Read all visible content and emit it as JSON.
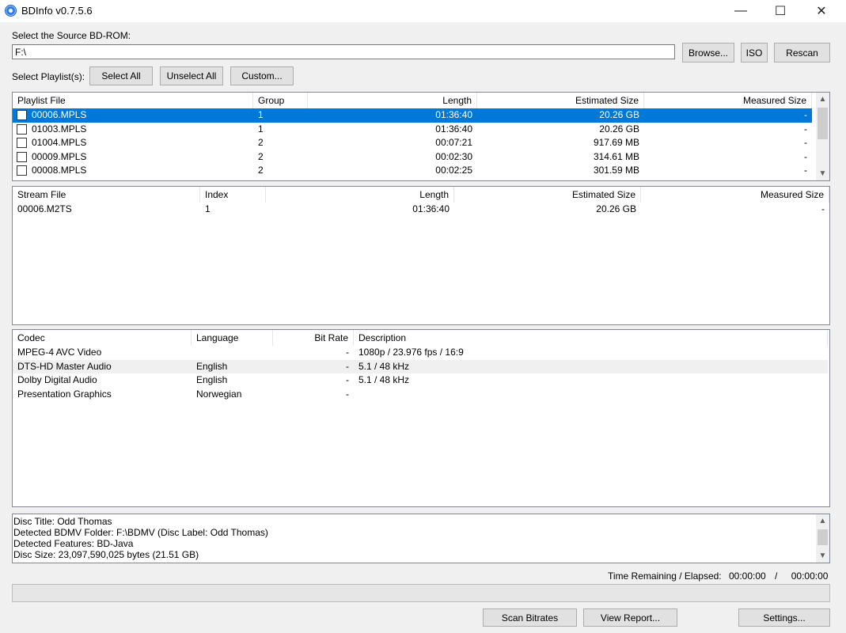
{
  "window": {
    "title": "BDInfo v0.7.5.6",
    "minimize": "—",
    "maximize": "☐",
    "close": "✕"
  },
  "source": {
    "label": "Select the Source BD-ROM:",
    "path": "F:\\",
    "browse_label": "Browse...",
    "iso_label": "ISO",
    "rescan_label": "Rescan"
  },
  "playlist_controls": {
    "label": "Select Playlist(s):",
    "select_all": "Select All",
    "unselect_all": "Unselect All",
    "custom": "Custom..."
  },
  "playlists": {
    "headers": [
      "Playlist File",
      "Group",
      "Length",
      "Estimated Size",
      "Measured Size"
    ],
    "rows": [
      {
        "file": "00006.MPLS",
        "group": "1",
        "length": "01:36:40",
        "est": "20.26 GB",
        "meas": "-",
        "selected": true
      },
      {
        "file": "01003.MPLS",
        "group": "1",
        "length": "01:36:40",
        "est": "20.26 GB",
        "meas": "-"
      },
      {
        "file": "01004.MPLS",
        "group": "2",
        "length": "00:07:21",
        "est": "917.69 MB",
        "meas": "-"
      },
      {
        "file": "00009.MPLS",
        "group": "2",
        "length": "00:02:30",
        "est": "314.61 MB",
        "meas": "-"
      },
      {
        "file": "00008.MPLS",
        "group": "2",
        "length": "00:02:25",
        "est": "301.59 MB",
        "meas": "-"
      }
    ]
  },
  "streams": {
    "headers": [
      "Stream File",
      "Index",
      "Length",
      "Estimated Size",
      "Measured Size"
    ],
    "rows": [
      {
        "file": "00006.M2TS",
        "index": "1",
        "length": "01:36:40",
        "est": "20.26 GB",
        "meas": "-"
      }
    ]
  },
  "codecs": {
    "headers": [
      "Codec",
      "Language",
      "Bit Rate",
      "Description"
    ],
    "rows": [
      {
        "codec": "MPEG-4 AVC Video",
        "lang": "",
        "bitrate": "-",
        "desc": "1080p / 23.976 fps / 16:9"
      },
      {
        "codec": "DTS-HD Master Audio",
        "lang": "English",
        "bitrate": "-",
        "desc": "5.1 / 48 kHz"
      },
      {
        "codec": "Dolby Digital Audio",
        "lang": "English",
        "bitrate": "-",
        "desc": "5.1 / 48 kHz"
      },
      {
        "codec": "Presentation Graphics",
        "lang": "Norwegian",
        "bitrate": "-",
        "desc": ""
      }
    ]
  },
  "log": {
    "lines": [
      "Disc Title: Odd Thomas",
      "Detected BDMV Folder: F:\\BDMV (Disc Label: Odd Thomas)",
      "Detected Features: BD-Java",
      "Disc Size: 23,097,590,025 bytes (21.51 GB)"
    ]
  },
  "status": {
    "time_label": "Time Remaining / Elapsed:",
    "remaining": "00:00:00",
    "separator": "/",
    "elapsed": "00:00:00",
    "progress": 0
  },
  "footer": {
    "scan_bitrates": "Scan Bitrates",
    "view_report": "View Report...",
    "settings": "Settings..."
  }
}
